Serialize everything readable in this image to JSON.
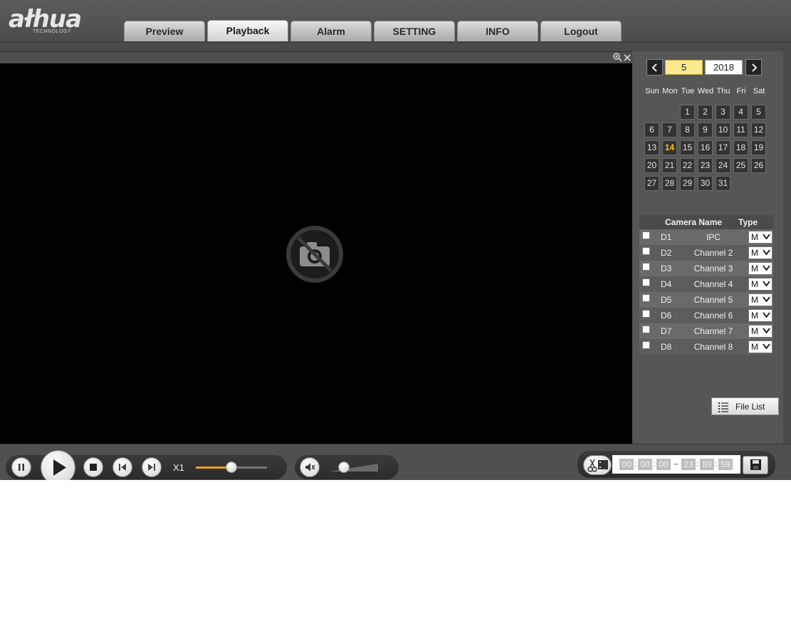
{
  "header": {
    "logo_text": "ałhua",
    "logo_sub": "TECHNOLOGY",
    "tabs": [
      {
        "label": "Preview",
        "active": false
      },
      {
        "label": "Playback",
        "active": true
      },
      {
        "label": "Alarm",
        "active": false
      },
      {
        "label": "SETTING",
        "active": false
      },
      {
        "label": "INFO",
        "active": false
      },
      {
        "label": "Logout",
        "active": false
      }
    ]
  },
  "video": {
    "toolbar_icons": [
      "zoom-in-icon",
      "close-icon"
    ],
    "placeholder_icon": "no-camera-icon"
  },
  "calendar": {
    "month": "5",
    "year": "2018",
    "prev_icon": "chevron-left-icon",
    "next_icon": "chevron-right-icon",
    "weekdays": [
      "Sun",
      "Mon",
      "Tue",
      "Wed",
      "Thu",
      "Fri",
      "Sat"
    ],
    "days": [
      "1",
      "2",
      "3",
      "4",
      "5",
      "6",
      "7",
      "8",
      "9",
      "10",
      "11",
      "12",
      "13",
      "14",
      "15",
      "16",
      "17",
      "18",
      "19",
      "20",
      "21",
      "22",
      "23",
      "24",
      "25",
      "26",
      "27",
      "28",
      "29",
      "30",
      "31"
    ],
    "first_weekday_index": 2,
    "highlight_day": "14",
    "highlight_color": "#ffc000"
  },
  "cameras": {
    "header_name": "Camera Name",
    "header_type": "Type",
    "rows": [
      {
        "id": "D1",
        "name": "IPC",
        "type": "M"
      },
      {
        "id": "D2",
        "name": "Channel 2",
        "type": "M"
      },
      {
        "id": "D3",
        "name": "Channel 3",
        "type": "M"
      },
      {
        "id": "D4",
        "name": "Channel 4",
        "type": "M"
      },
      {
        "id": "D5",
        "name": "Channel 5",
        "type": "M"
      },
      {
        "id": "D6",
        "name": "Channel 6",
        "type": "M"
      },
      {
        "id": "D7",
        "name": "Channel 7",
        "type": "M"
      },
      {
        "id": "D8",
        "name": "Channel 8",
        "type": "M"
      }
    ]
  },
  "file_list": {
    "label": "File List",
    "icon": "list-icon"
  },
  "controls": {
    "speed": "X1",
    "speed_slider_level": 0.5,
    "volume_level": 0.3,
    "buttons": [
      "pause-icon",
      "play-icon",
      "stop-icon",
      "previous-frame-icon",
      "next-frame-icon",
      "mute-icon",
      "clip-icon",
      "save-icon"
    ],
    "time_start": {
      "h": "00",
      "m": "00",
      "s": "00"
    },
    "time_end": {
      "h": "23",
      "m": "59",
      "s": "59"
    },
    "time_separator": ":",
    "range_separator": "~"
  },
  "colors": {
    "accent": "#f0a020",
    "month_field": "#fbe98f"
  }
}
